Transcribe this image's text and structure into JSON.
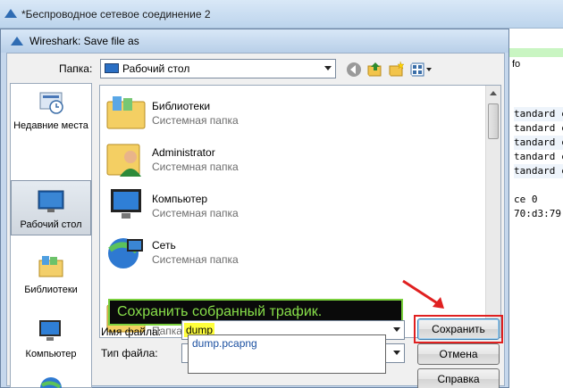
{
  "background_window": {
    "title": "*Беспроводное сетевое соединение 2",
    "info_header": "fo",
    "lines": [
      "tandard c",
      "tandard c",
      "tandard c",
      "tandard c",
      "tandard c",
      "",
      "ce 0",
      "70:d3:79"
    ]
  },
  "dialog": {
    "title": "Wireshark: Save file as",
    "folder_label": "Папка:",
    "folder_value": "Рабочий стол",
    "places": [
      {
        "label": "Недавние места",
        "icon": "recent-places-icon"
      },
      {
        "label": "Рабочий стол",
        "icon": "desktop-icon"
      },
      {
        "label": "Библиотеки",
        "icon": "libraries-icon"
      },
      {
        "label": "Компьютер",
        "icon": "computer-icon"
      }
    ],
    "files": [
      {
        "name": "Библиотеки",
        "type": "Системная папка",
        "icon": "libraries-icon"
      },
      {
        "name": "Administrator",
        "type": "Системная папка",
        "icon": "user-folder-icon"
      },
      {
        "name": "Компьютер",
        "type": "Системная папка",
        "icon": "computer-icon"
      },
      {
        "name": "Сеть",
        "type": "Системная папка",
        "icon": "network-icon"
      },
      {
        "name": "",
        "type": "Папка с файлами",
        "icon": "folder-icon"
      }
    ],
    "filename_label": "Имя файла:",
    "filename_value": "dump",
    "filetype_label": "Тип файла:",
    "autocomplete": [
      "dump.pcapng"
    ],
    "save_button": "Сохранить",
    "cancel_button": "Отмена",
    "help_button": "Справка"
  },
  "annotation": {
    "callout_text": "Сохранить собранный трафик.",
    "callout_color": "#88e04a",
    "highlight_color": "#e02020"
  }
}
